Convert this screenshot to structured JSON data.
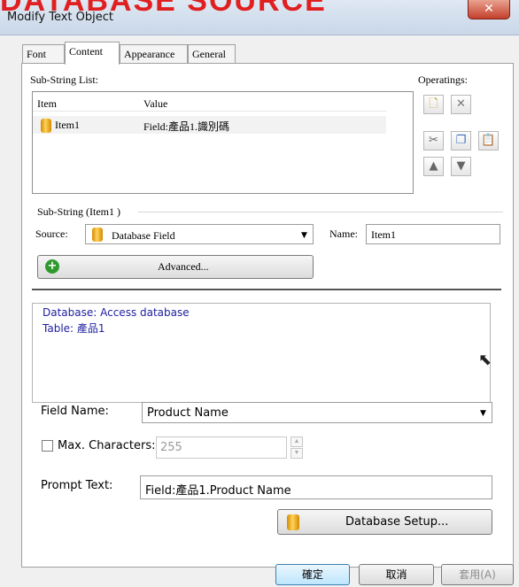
{
  "banner": {
    "text": "DATABASE SOURCE"
  },
  "window": {
    "title": "Modify Text Object",
    "close_glyph": "✕"
  },
  "tabs": [
    {
      "label": "Font"
    },
    {
      "label": "Content"
    },
    {
      "label": "Appearance"
    },
    {
      "label": "General"
    }
  ],
  "substring_list": {
    "label": "Sub-String List:",
    "columns": [
      "Item",
      "Value"
    ],
    "rows": [
      {
        "item": "Item1",
        "value": "Field:產品1.識別碼"
      }
    ]
  },
  "operatings": {
    "label": "Operatings:",
    "icons": [
      "new-icon",
      "delete-icon",
      "cut-icon",
      "copy-icon",
      "paste-icon",
      "move-up-icon",
      "move-down-icon"
    ]
  },
  "substring": {
    "group_label": "Sub-String (Item1 )",
    "source_label": "Source:",
    "source_value": "Database Field",
    "name_label": "Name:",
    "name_value": "Item1",
    "advanced_label": "Advanced..."
  },
  "info": {
    "line1": "Database: Access database",
    "line2": "Table: 產品1"
  },
  "field_name": {
    "label": "Field Name:",
    "value": "Product Name"
  },
  "max_chars": {
    "label": "Max. Characters:",
    "value": "255",
    "checked": false
  },
  "prompt_text": {
    "label": "Prompt Text:",
    "value": "Field:產品1.Product Name"
  },
  "database_setup": {
    "label": "Database Setup..."
  },
  "footer": {
    "ok": "確定",
    "cancel": "取消",
    "apply": "套用(A)"
  },
  "colors": {
    "info_text": "#2020a0",
    "banner": "#e02020",
    "dialog_bg": "#f0f0f0"
  }
}
